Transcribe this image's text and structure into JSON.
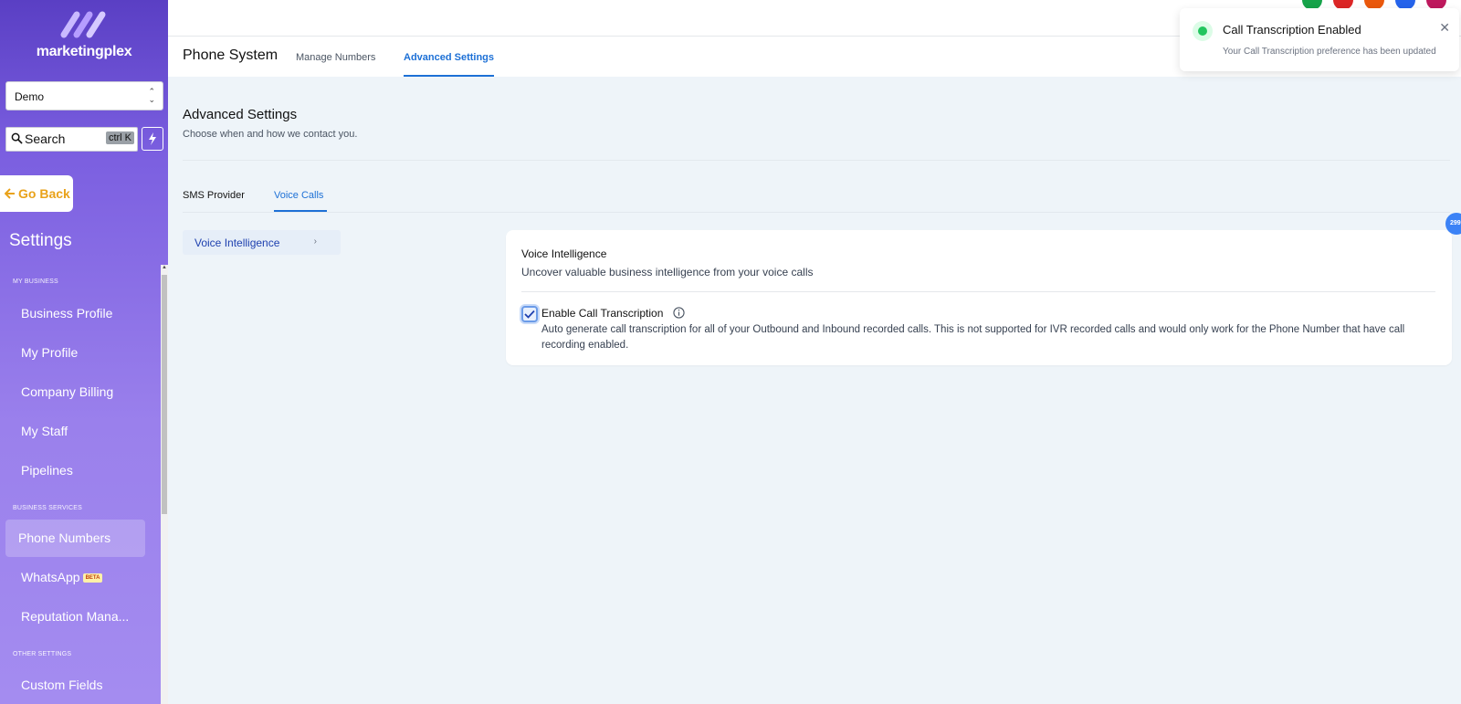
{
  "sidebar": {
    "logo_text": "marketingplex",
    "account": "Demo",
    "search_label": "Search",
    "search_shortcut": "ctrl K",
    "go_back": "Go Back",
    "settings_title": "Settings",
    "sections": {
      "my_business": "MY BUSINESS",
      "business_services": "BUSINESS SERVICES",
      "other_settings": "OTHER SETTINGS"
    },
    "items": {
      "business_profile": "Business Profile",
      "my_profile": "My Profile",
      "company_billing": "Company Billing",
      "my_staff": "My Staff",
      "pipelines": "Pipelines",
      "phone_numbers": "Phone Numbers",
      "whatsapp": "WhatsApp",
      "whatsapp_badge": "BETA",
      "reputation": "Reputation Mana...",
      "custom_fields": "Custom Fields"
    }
  },
  "header": {
    "title": "Phone System",
    "tabs": [
      "Manage Numbers",
      "Advanced Settings"
    ],
    "active_tab": "Advanced Settings"
  },
  "content": {
    "heading": "Advanced Settings",
    "subheading": "Choose when and how we contact you.",
    "sub_tabs": [
      "SMS Provider",
      "Voice Calls"
    ],
    "active_sub_tab": "Voice Calls",
    "side_menu": [
      "Voice Intelligence"
    ],
    "card": {
      "title": "Voice Intelligence",
      "subtitle": "Uncover valuable business intelligence from your voice calls",
      "option_label": "Enable Call Transcription",
      "option_checked": true,
      "option_description": "Auto generate call transcription for all of your Outbound and Inbound recorded calls. This is not supported for IVR recorded calls and would only work for the Phone Number that have call recording enabled."
    },
    "side_badge": "299"
  },
  "toast": {
    "title": "Call Transcription Enabled",
    "message": "Your Call Transcription preference has been updated"
  },
  "colors": {
    "accent": "#1d70d6",
    "sidebar_top": "#5a3fc4",
    "sidebar_bottom": "#a48cf0",
    "go_back": "#e9a21a",
    "success": "#22c55e"
  },
  "header_avatars": [
    "#16a34a",
    "#dc2626",
    "#ea580c",
    "#2563eb",
    "#be185d"
  ]
}
